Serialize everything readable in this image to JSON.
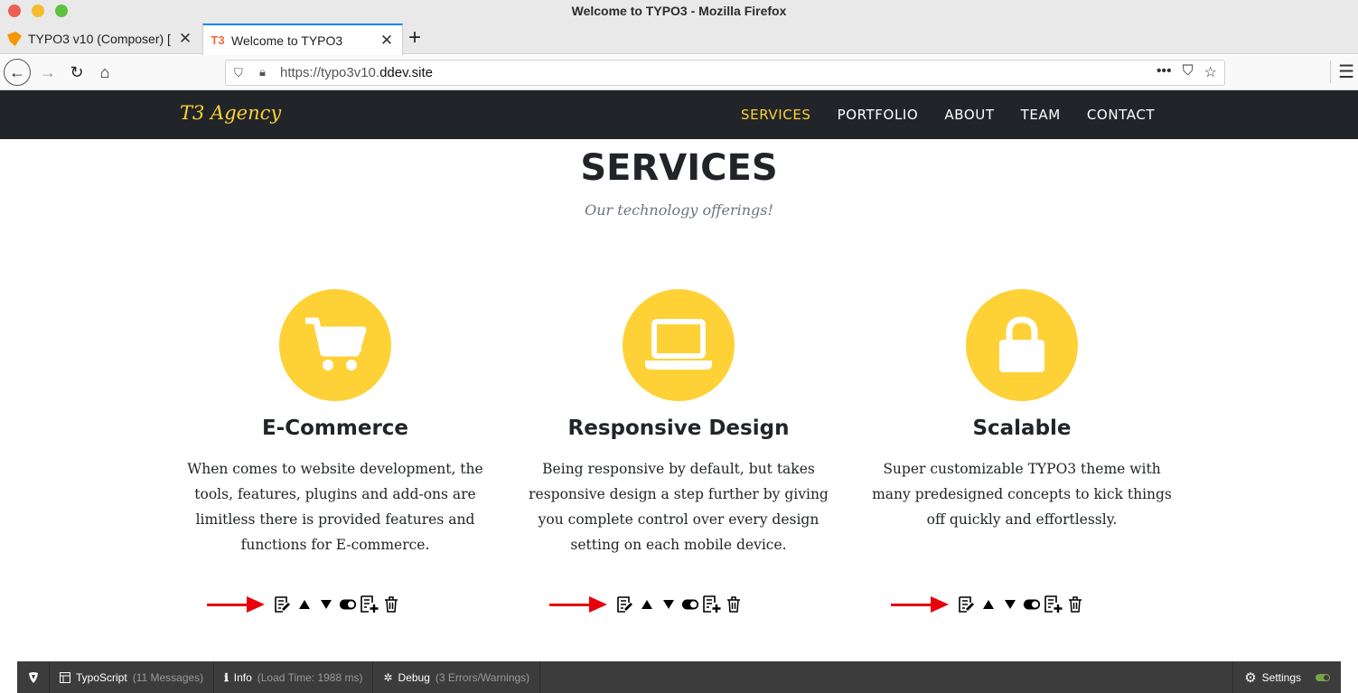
{
  "window": {
    "title": "Welcome to TYPO3 - Mozilla Firefox"
  },
  "tabs": [
    {
      "label": "TYPO3 v10 (Composer) [",
      "favicon": "typo3-icon"
    },
    {
      "label": "Welcome to TYPO3",
      "favicon": "T3"
    }
  ],
  "address_bar": {
    "url_prefix": "https://typo3v10.",
    "url_host": "ddev.site"
  },
  "site": {
    "brand": "T3 Agency",
    "menu": [
      "SERVICES",
      "PORTFOLIO",
      "ABOUT",
      "TEAM",
      "CONTACT"
    ],
    "active_menu": "SERVICES",
    "accent_color": "#fed136",
    "header_bg": "#212529"
  },
  "services_section": {
    "heading": "SERVICES",
    "subheading": "Our technology offerings!",
    "items": [
      {
        "title": "E-Commerce",
        "icon": "shopping-cart-icon",
        "text": "When comes to website development, the tools, features, plugins and add-ons are limitless there is provided features and functions for E-commerce."
      },
      {
        "title": "Responsive Design",
        "icon": "laptop-icon",
        "text": "Being responsive by default, but takes responsive design a step further by giving you complete control over every design setting on each mobile device."
      },
      {
        "title": "Scalable",
        "icon": "lock-icon",
        "text": "Super customizable TYPO3 theme with many predesigned concepts to kick things off quickly and effortlessly."
      }
    ]
  },
  "admin_panel": {
    "typoscript_label": "TypoScript",
    "typoscript_detail": "(11 Messages)",
    "info_label": "Info",
    "info_detail": "(Load Time: 1988 ms)",
    "debug_label": "Debug",
    "debug_detail": "(3 Errors/Warnings)",
    "settings_label": "Settings"
  }
}
